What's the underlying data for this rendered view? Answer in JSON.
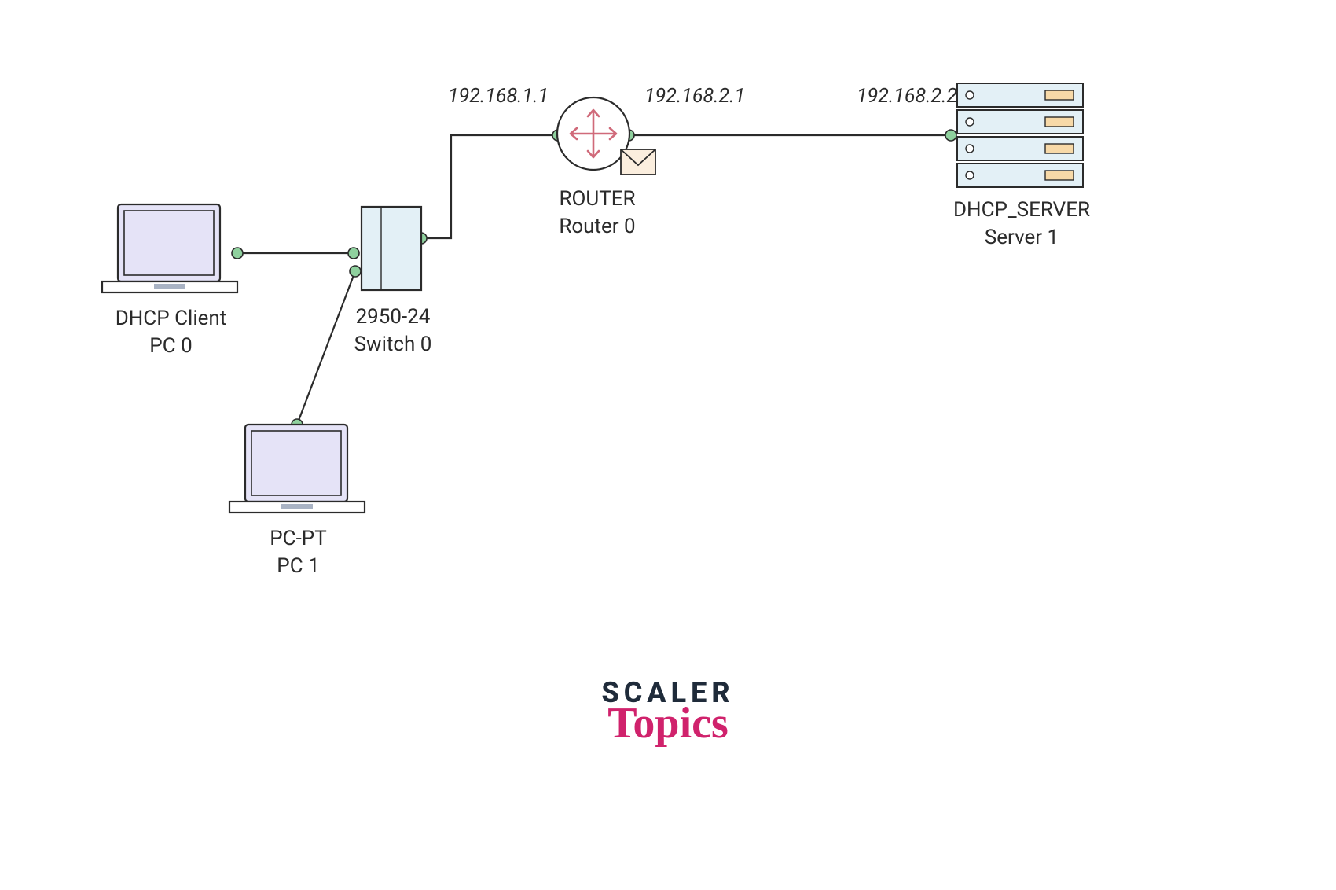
{
  "nodes": {
    "pc0": {
      "title": "DHCP Client",
      "name": "PC 0"
    },
    "pc1": {
      "title": "PC-PT",
      "name": "PC 1"
    },
    "switch0": {
      "title": "2950-24",
      "name": "Switch 0"
    },
    "router0": {
      "title": "ROUTER",
      "name": "Router 0"
    },
    "server1": {
      "title": "DHCP_SERVER",
      "name": "Server 1"
    }
  },
  "ips": {
    "router_left": "192.168.1.1",
    "router_right": "192.168.2.1",
    "server": "192.168.2.2"
  },
  "branding": {
    "line1": "SCALER",
    "line2": "Topics"
  },
  "colors": {
    "stroke": "#2b2b2b",
    "laptop_fill": "#e5e3f7",
    "switch_fill": "#e3f0f6",
    "router_fill": "#ffffff",
    "router_arrows": "#d06a7a",
    "server_fill": "#e3f0f6",
    "server_light": "#f7d9a8",
    "port_dot": "#8fd19e",
    "envelope_fill": "#fbeede"
  }
}
